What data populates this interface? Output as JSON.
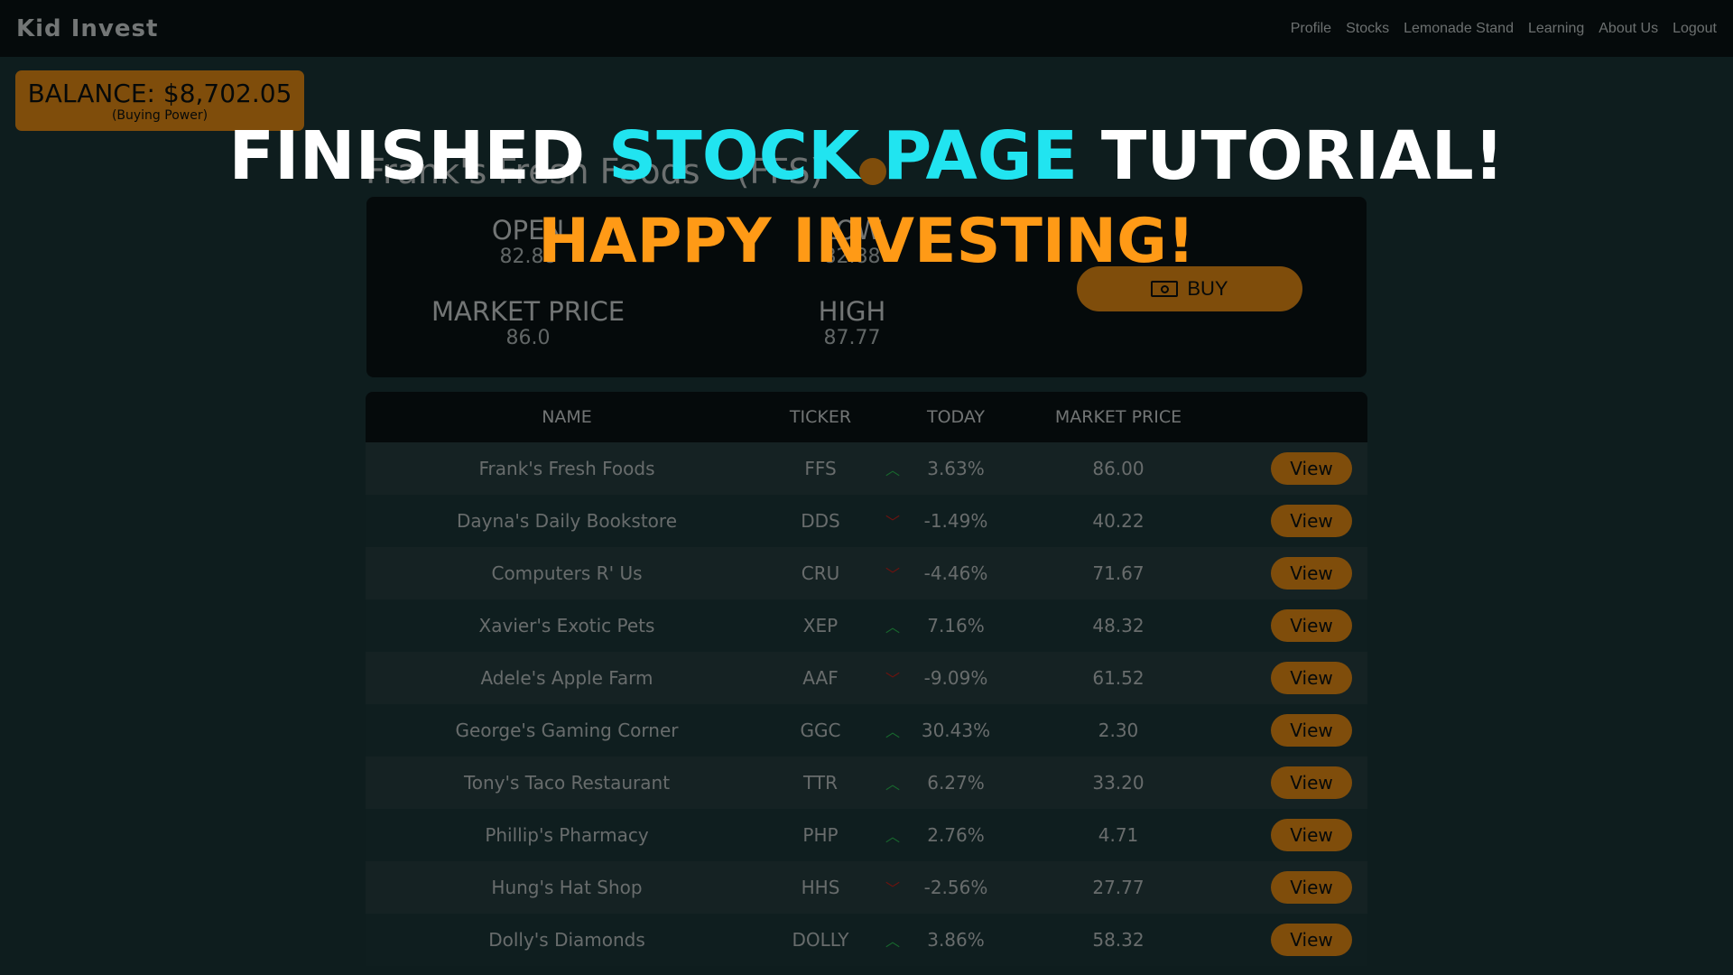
{
  "nav": {
    "brand": "Kid Invest",
    "links": [
      "Profile",
      "Stocks",
      "Lemonade Stand",
      "Learning",
      "About Us",
      "Logout"
    ]
  },
  "balance": {
    "amount": "BALANCE: $8,702.05",
    "subtitle": "(Buying Power)"
  },
  "stock": {
    "name": "Frank's Fresh Foods",
    "ticker": "(FFS)",
    "open_label": "OPEN",
    "open_value": "82.88",
    "low_label": "LOW",
    "low_value": "82.88",
    "market_label": "MARKET PRICE",
    "market_value": "86.0",
    "high_label": "HIGH",
    "high_value": "87.77",
    "buy_label": "BUY",
    "cash_icon": "cash-icon"
  },
  "table": {
    "headers": [
      "NAME",
      "TICKER",
      "TODAY",
      "MARKET PRICE"
    ],
    "view_label": "View",
    "rows": [
      {
        "name": "Frank's Fresh Foods",
        "ticker": "FFS",
        "dir": "up",
        "today": "3.63%",
        "price": "86.00"
      },
      {
        "name": "Dayna's Daily Bookstore",
        "ticker": "DDS",
        "dir": "down",
        "today": "-1.49%",
        "price": "40.22"
      },
      {
        "name": "Computers R' Us",
        "ticker": "CRU",
        "dir": "down",
        "today": "-4.46%",
        "price": "71.67"
      },
      {
        "name": "Xavier's Exotic Pets",
        "ticker": "XEP",
        "dir": "up",
        "today": "7.16%",
        "price": "48.32"
      },
      {
        "name": "Adele's Apple Farm",
        "ticker": "AAF",
        "dir": "down",
        "today": "-9.09%",
        "price": "61.52"
      },
      {
        "name": "George's Gaming Corner",
        "ticker": "GGC",
        "dir": "up",
        "today": "30.43%",
        "price": "2.30"
      },
      {
        "name": "Tony's Taco Restaurant",
        "ticker": "TTR",
        "dir": "up",
        "today": "6.27%",
        "price": "33.20"
      },
      {
        "name": "Phillip's Pharmacy",
        "ticker": "PHP",
        "dir": "up",
        "today": "2.76%",
        "price": "4.71"
      },
      {
        "name": "Hung's Hat Shop",
        "ticker": "HHS",
        "dir": "down",
        "today": "-2.56%",
        "price": "27.77"
      },
      {
        "name": "Dolly's Diamonds",
        "ticker": "DOLLY",
        "dir": "up",
        "today": "3.86%",
        "price": "58.32"
      }
    ]
  },
  "overlay": {
    "title_part1": "FINISHED ",
    "title_accent": "STOCK PAGE",
    "title_part2": " TUTORIAL!",
    "subtitle": "HAPPY INVESTING!"
  },
  "colors": {
    "accent_orange": "#ff9a16",
    "accent_cyan": "#21e4f0",
    "up_green": "#2fd15a",
    "down_red": "#e0241c"
  }
}
